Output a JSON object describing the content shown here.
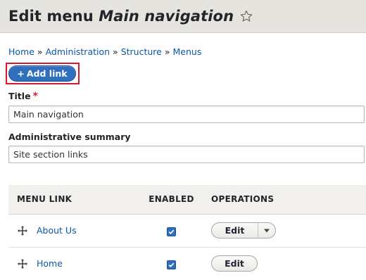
{
  "header": {
    "title_prefix": "Edit menu",
    "menu_name": "Main navigation",
    "star_icon": "star-outline-icon"
  },
  "breadcrumb": {
    "items": [
      "Home",
      "Administration",
      "Structure",
      "Menus"
    ],
    "separator": "»"
  },
  "actions": {
    "add_link_plus": "+",
    "add_link_label": "Add link"
  },
  "form": {
    "title_label": "Title",
    "required_marker": "*",
    "title_value": "Main navigation",
    "summary_label": "Administrative summary",
    "summary_value": "Site section links"
  },
  "table": {
    "headers": {
      "menu_link": "MENU LINK",
      "enabled": "ENABLED",
      "operations": "OPERATIONS"
    },
    "rows": [
      {
        "label": "About Us",
        "enabled": true,
        "operation": "Edit",
        "has_dropdown": true
      },
      {
        "label": "Home",
        "enabled": true,
        "operation": "Edit",
        "has_dropdown": false
      }
    ]
  },
  "colors": {
    "link": "#0b57a3",
    "primary_button": "#2f6fbd",
    "highlight_border": "#d8182c",
    "required": "#c7233a",
    "header_bg": "#e6e4df"
  }
}
